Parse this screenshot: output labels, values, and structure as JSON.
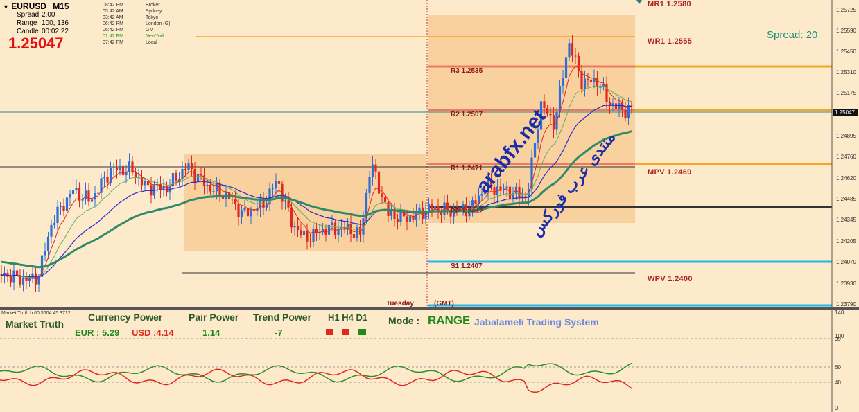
{
  "header": {
    "symbol": "EURUSD",
    "timeframe": "M15",
    "spread_label": "Spread",
    "spread_value": "2.00",
    "range_label": "Range",
    "range_value": "100, 136",
    "candle_label": "Candle",
    "candle_value": "00:02:22",
    "bid": "1.25047"
  },
  "sessions": [
    {
      "time": "08:42 PM",
      "name": "Broker"
    },
    {
      "time": "05:42 AM",
      "name": "Sydney"
    },
    {
      "time": "03:42 AM",
      "name": "Tokyo"
    },
    {
      "time": "06:42 PM",
      "name": "London  (G)"
    },
    {
      "time": "06:42 PM",
      "name": "GMT"
    },
    {
      "time": "01:42 PM",
      "name": "NewYork"
    },
    {
      "time": "07:42 PM",
      "name": "Local"
    }
  ],
  "spread_display": "Spread: 20",
  "levels": {
    "mr1": "MR1   1.2580",
    "wr1": "WR1   1.2555",
    "mpv": "MPV   1.2469",
    "wpv": "WPV   1.2400",
    "r3": "R3   1.2535",
    "r2": "R2   1.2507",
    "r1": "R1   1.2471",
    "pp": "PP   1.2442",
    "s1": "S1   1.2407"
  },
  "session_label": "Tuesday",
  "gmt_label": "(GMT)",
  "price_axis": [
    "1.25725",
    "1.25590",
    "1.25450",
    "1.25310",
    "1.25175",
    "1.25047",
    "1.24895",
    "1.24760",
    "1.24620",
    "1.24485",
    "1.24345",
    "1.24205",
    "1.24070",
    "1.23930",
    "1.23790"
  ],
  "current_price_tag": "1.25047",
  "indicator": {
    "header": "Market Truth b 60.3604 45.3712",
    "title": "Market Truth",
    "currency_power_label": "Currency Power",
    "eur": "EUR : 5.29",
    "usd": "USD :4.14",
    "pair_power_label": "Pair Power",
    "pair_power_value": "1.14",
    "trend_power_label": "Trend Power",
    "trend_power_value": "-7",
    "tf_label": "H1 H4 D1",
    "mode_label": "Mode  :",
    "mode_value": "RANGE",
    "system_name": "Jabalameli Trading System",
    "axis": [
      "140",
      "100",
      "99",
      "60",
      "40",
      "0"
    ]
  },
  "watermark": {
    "arabic": "منتدى عرب فوركس",
    "site": "arabfx.net"
  },
  "colors": {
    "bull": "#2d6fd6",
    "bear": "#e0281e",
    "box": "#f5c88f",
    "orange": "#f5a623",
    "cyan": "#1fb8e8",
    "power_green": "#2e8b2e",
    "power_red": "#e0281e"
  }
}
